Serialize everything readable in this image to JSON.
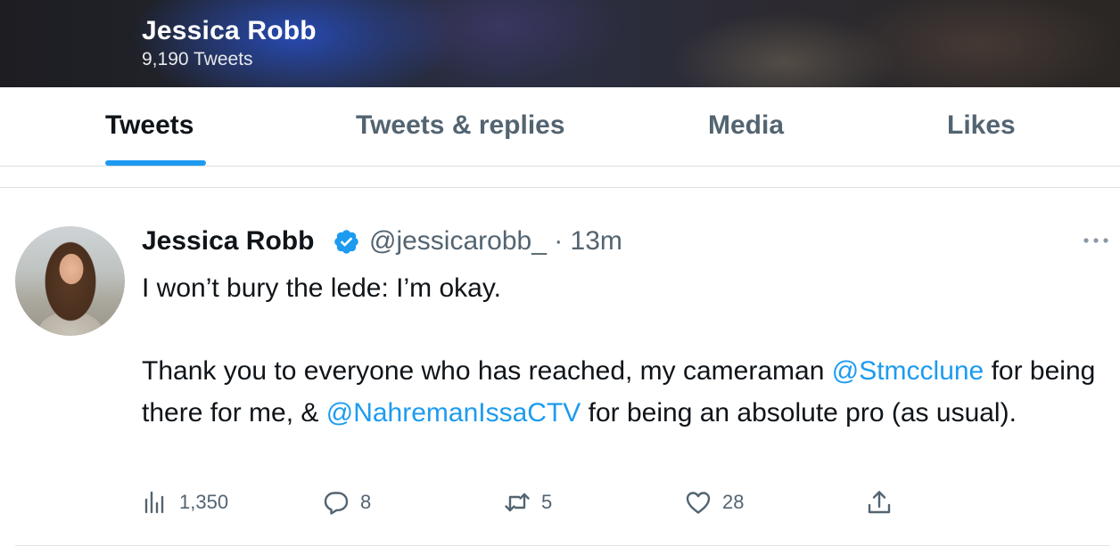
{
  "header": {
    "name": "Jessica Robb",
    "tweet_count": "9,190 Tweets"
  },
  "tabs": [
    {
      "label": "Tweets",
      "active": true
    },
    {
      "label": "Tweets & replies",
      "active": false
    },
    {
      "label": "Media",
      "active": false
    },
    {
      "label": "Likes",
      "active": false
    }
  ],
  "tweet": {
    "author_name": "Jessica Robb",
    "verified": true,
    "handle_time": "@jessicarobb_ · 13m",
    "text": {
      "line1": "I won’t bury the lede: I’m okay.",
      "p2_a": "Thank you to everyone who has reached, my cameraman ",
      "mention1": "@Stmcclune",
      "p2_b": " for being there for me, & ",
      "mention2": "@NahremanIssaCTV",
      "p2_c": " for being an absolute pro (as usual)."
    },
    "actions": {
      "views": "1,350",
      "replies": "8",
      "retweets": "5",
      "likes": "28"
    }
  },
  "colors": {
    "accent": "#1d9bf0",
    "secondary_text": "#536471",
    "primary_text": "#0f1419"
  },
  "icons": [
    "verified-badge-icon",
    "more-icon",
    "views-icon",
    "reply-icon",
    "retweet-icon",
    "like-icon",
    "share-icon"
  ]
}
